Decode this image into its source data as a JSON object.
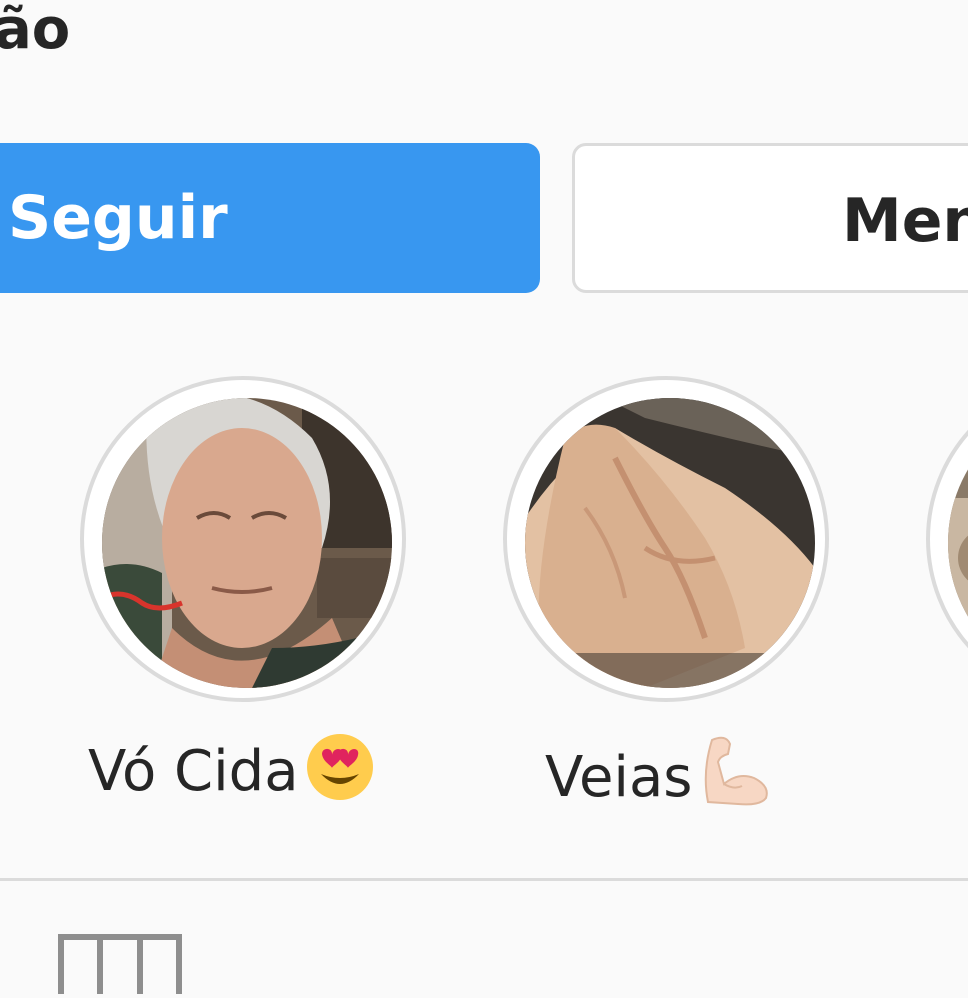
{
  "profile": {
    "truncated_text": "ão"
  },
  "actions": {
    "follow_label": "Seguir",
    "message_label": "Men"
  },
  "highlights": [
    {
      "label": "Vó Cida",
      "emoji": "smiling-face-with-heart-eyes"
    },
    {
      "label": "Veias",
      "emoji": "flexed-biceps"
    }
  ],
  "tabs": {
    "grid_icon": "grid-icon"
  },
  "colors": {
    "background": "#fafafa",
    "primary_button": "#3897f0",
    "border": "#dbdbdb",
    "text": "#262626"
  }
}
